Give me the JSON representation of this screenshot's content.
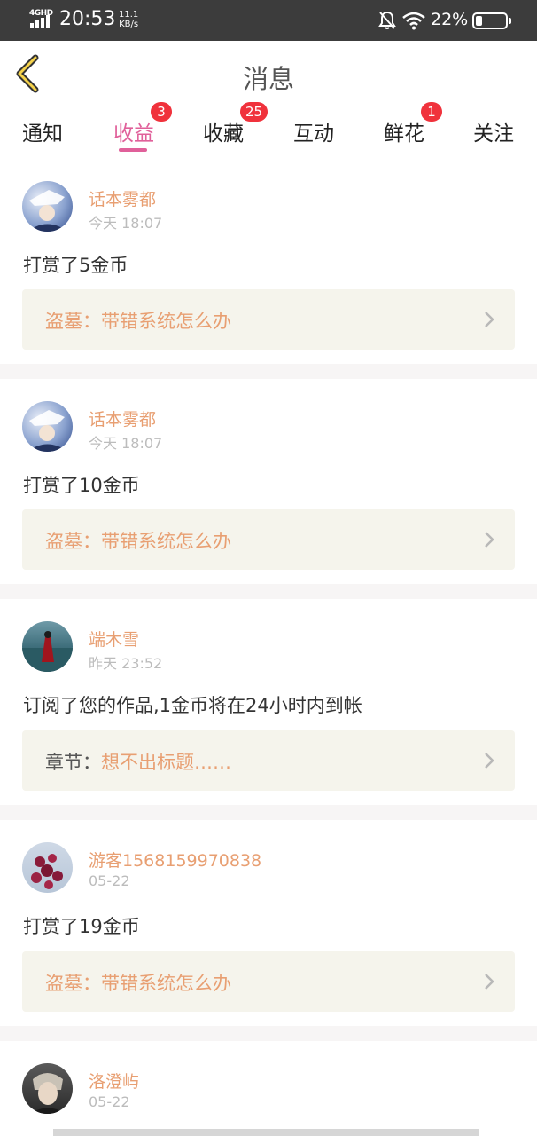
{
  "status_bar": {
    "network": "4GHD",
    "time": "20:53",
    "speed_value": "11.1",
    "speed_unit": "KB/s",
    "battery_pct": "22%",
    "battery_level": 0.22
  },
  "header": {
    "title": "消息"
  },
  "tabs": [
    {
      "label": "通知",
      "badge": ""
    },
    {
      "label": "收益",
      "badge": "3"
    },
    {
      "label": "收藏",
      "badge": "25"
    },
    {
      "label": "互动",
      "badge": ""
    },
    {
      "label": "鲜花",
      "badge": "1"
    },
    {
      "label": "关注",
      "badge": ""
    }
  ],
  "active_tab": "收益",
  "colors": {
    "accent": "#e0609a",
    "name": "#e89f72",
    "badge": "#f0323c",
    "ref_bg": "#f5f4ec"
  },
  "messages": [
    {
      "user": "话本雾都",
      "time": "今天 18:07",
      "action": "打赏了5金币",
      "ref_label": "盗墓：",
      "ref_title": "带错系统怎么办"
    },
    {
      "user": "话本雾都",
      "time": "今天 18:07",
      "action": "打赏了10金币",
      "ref_label": "盗墓：",
      "ref_title": "带错系统怎么办"
    },
    {
      "user": "端木雪",
      "time": "昨天 23:52",
      "action": "订阅了您的作品,1金币将在24小时内到帐",
      "ref_label": "章节：",
      "ref_title": "想不出标题……"
    },
    {
      "user": "游客1568159970838",
      "time": "05-22",
      "action": "打赏了19金币",
      "ref_label": "盗墓：",
      "ref_title": "带错系统怎么办"
    },
    {
      "user": "洛澄屿",
      "time": "05-22"
    }
  ]
}
